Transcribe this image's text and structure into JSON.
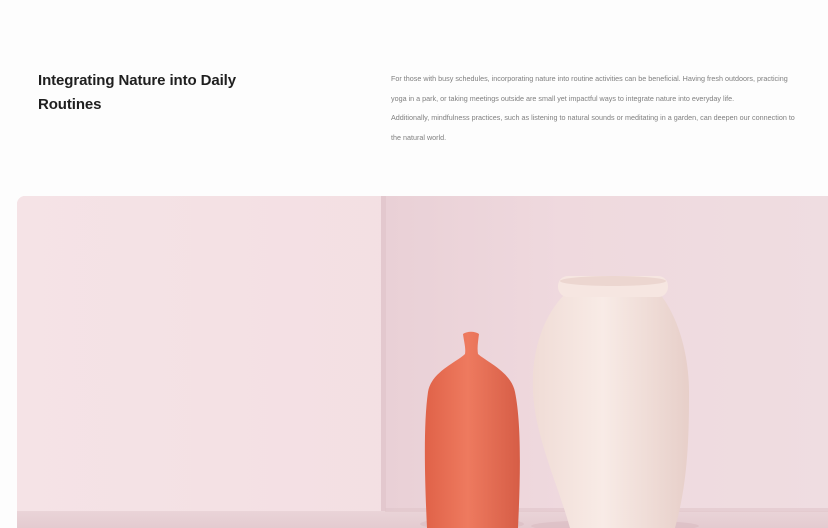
{
  "section": {
    "heading": "Integrating Nature into Daily Routines",
    "paragraphs": [
      "For those with busy schedules, incorporating nature into routine activities can be beneficial. Having fresh outdoors, practicing yoga in a park, or taking meetings outside are small yet impactful ways to integrate nature into everyday life.",
      "Additionally, mindfulness practices, such as listening to natural sounds or meditating in a garden, can deepen our connection to the natural world."
    ]
  },
  "colors": {
    "background": "#fdfdfd",
    "heading": "#1f1f1f",
    "body": "#7f7f7f",
    "wall_left": "#f3dfe2",
    "wall_right": "#edd6dc",
    "terracotta": "#ea6e54",
    "cream": "#f3ded8"
  }
}
